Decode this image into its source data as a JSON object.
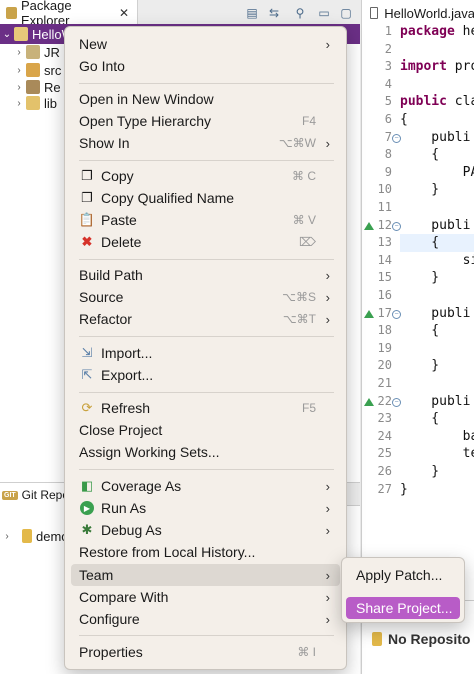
{
  "package_explorer": {
    "tab_title": "Package Explorer",
    "close_glyph": "✕",
    "tools": [
      "collapse-all-icon",
      "link-with-editor-icon",
      "filter-icon",
      "view-menu-icon",
      "minimize-icon"
    ],
    "tree": [
      {
        "label": "HelloW",
        "icon": "project-icon",
        "selected": true
      },
      {
        "label": "JR",
        "icon": "library-icon"
      },
      {
        "label": "src",
        "icon": "source-folder-icon"
      },
      {
        "label": "Re",
        "icon": "referenced-libraries-icon"
      },
      {
        "label": "lib",
        "icon": "folder-icon"
      }
    ]
  },
  "git_repositories": {
    "tab_title": "Git Repo",
    "tab_icon_text": "GIT",
    "repo": "demo"
  },
  "editor": {
    "tab_title": "HelloWorld.java",
    "line_numbers": [
      "1",
      "2",
      "3",
      "4",
      "5",
      "6",
      "7",
      "8",
      "9",
      "10",
      "11",
      "12",
      "13",
      "14",
      "15",
      "16",
      "17",
      "18",
      "19",
      "20",
      "21",
      "22",
      "23",
      "24",
      "25",
      "26",
      "27"
    ],
    "lines": {
      "l1": "package he",
      "l3": "import pro",
      "l5": "public cla",
      "l6": "{",
      "l7": "    publi",
      "l8": "    {",
      "l9": "        PA",
      "l10": "    }",
      "l12": "    publi",
      "l13": "    {",
      "l14": "        si",
      "l15": "    }",
      "l17": "    publi",
      "l18": "    {",
      "l20": "    }",
      "l22": "    publi",
      "l23": "    {",
      "l24": "        ba",
      "l25": "        te",
      "l26": "    }",
      "l27": "}"
    }
  },
  "no_repo_text": "No Reposito",
  "context_menu": {
    "items": {
      "new": "New",
      "go_into": "Go Into",
      "open_new_window": "Open in New Window",
      "open_type_hierarchy": "Open Type Hierarchy",
      "open_type_hierarchy_sc": "F4",
      "show_in": "Show In",
      "show_in_sc": "⌥⌘W",
      "copy": "Copy",
      "copy_sc": "⌘ C",
      "copy_qualified": "Copy Qualified Name",
      "paste": "Paste",
      "paste_sc": "⌘ V",
      "delete": "Delete",
      "delete_sc": "⌦",
      "build_path": "Build Path",
      "source": "Source",
      "source_sc": "⌥⌘S",
      "refactor": "Refactor",
      "refactor_sc": "⌥⌘T",
      "import": "Import...",
      "export": "Export...",
      "refresh": "Refresh",
      "refresh_sc": "F5",
      "close_project": "Close Project",
      "assign_working_sets": "Assign Working Sets...",
      "coverage_as": "Coverage As",
      "run_as": "Run As",
      "debug_as": "Debug As",
      "restore_local_history": "Restore from Local History...",
      "team": "Team",
      "compare_with": "Compare With",
      "configure": "Configure",
      "properties": "Properties",
      "properties_sc": "⌘ I"
    },
    "arrow_glyph": "›"
  },
  "team_submenu": {
    "apply_patch": "Apply Patch...",
    "share_project": "Share Project..."
  },
  "colors": {
    "selection": "#6b2f86",
    "submenu_highlight": "#b85cc7",
    "keyword": "#7f0055"
  }
}
